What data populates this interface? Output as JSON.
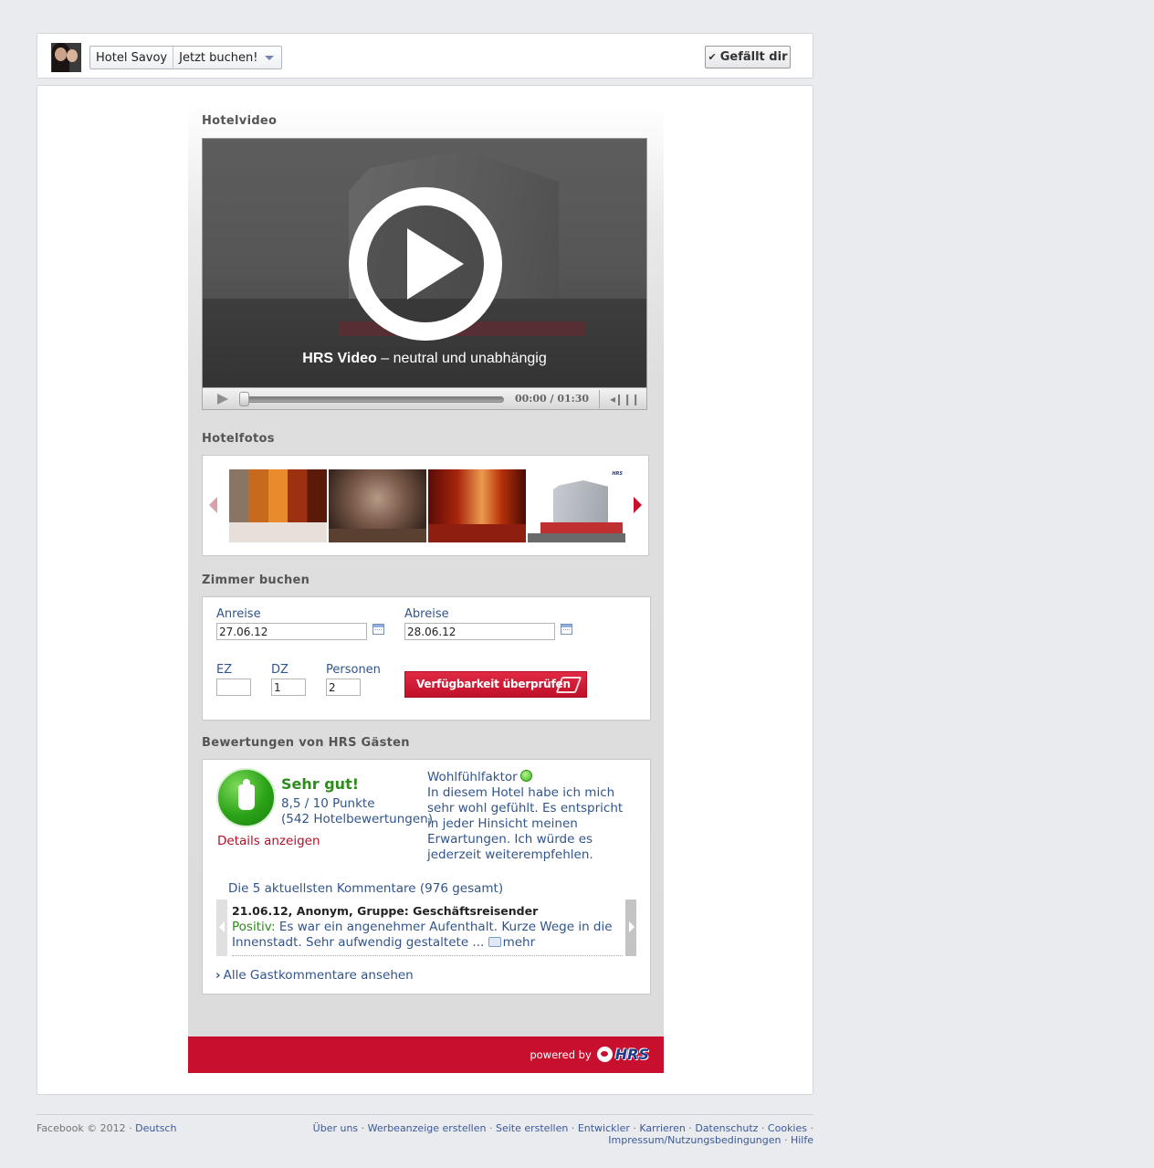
{
  "topbar": {
    "page_name": "Hotel Savoy",
    "tab_name": "Jetzt buchen!",
    "like_label": "Gefällt dir"
  },
  "sections": {
    "video_title": "Hotelvideo",
    "photos_title": "Hotelfotos",
    "booking_title": "Zimmer buchen",
    "reviews_title": "Bewertungen von HRS Gästen"
  },
  "video": {
    "caption_bold": "HRS Video",
    "caption_rest": " – neutral und unabhängig",
    "time": "00:00 / 01:30",
    "progress": 0
  },
  "booking": {
    "arrival_label": "Anreise",
    "arrival_value": "27.06.12",
    "departure_label": "Abreise",
    "departure_value": "28.06.12",
    "ez_label": "EZ",
    "ez_value": "",
    "dz_label": "DZ",
    "dz_value": "1",
    "persons_label": "Personen",
    "persons_value": "2",
    "check_button": "Verfügbarkeit überprüfen"
  },
  "reviews": {
    "rating_word": "Sehr gut!",
    "score": "8,5 / 10 Punkte",
    "count": "(542 Hotelbewertungen)",
    "details_link": "Details anzeigen",
    "wellbeing_title": "Wohlfühlfaktor",
    "wellbeing_text": "In diesem Hotel habe ich mich sehr wohl gefühlt. Es entspricht in jeder Hinsicht meinen Erwartungen. Ich würde es jederzeit weiterempfehlen.",
    "comments_heading": "Die 5 aktuellsten Kommentare (976 gesamt)",
    "comment_header": "21.06.12, Anonym, Gruppe: Geschäftsreisender",
    "comment_positive_label": "Positiv:",
    "comment_text": " Es war ein angenehmer Aufenthalt. Kurze Wege in die Innenstadt. Sehr aufwendig gestaltete ... ",
    "comment_more": "mehr",
    "all_comments_link": "Alle Gastkommentare ansehen"
  },
  "powered": {
    "text": "powered by",
    "brand": "HRS"
  },
  "footer": {
    "copyright": "Facebook © 2012 · ",
    "language": "Deutsch",
    "links": [
      "Über uns",
      "Werbeanzeige erstellen",
      "Seite erstellen",
      "Entwickler",
      "Karrieren",
      "Datenschutz",
      "Cookies",
      "Impressum/Nutzungsbedingungen",
      "Hilfe"
    ]
  },
  "colors": {
    "hrs_red": "#c8102e",
    "link_blue": "#31548b",
    "good_green": "#2e8b1e"
  },
  "icons": [
    "check-icon",
    "dropdown-arrow-icon",
    "play-icon",
    "volume-icon",
    "calendar-icon",
    "bed-icon",
    "thumbs-up-icon",
    "smiley-icon",
    "comment-bubble-icon",
    "chevron-right-icon",
    "hrs-logo-icon"
  ]
}
